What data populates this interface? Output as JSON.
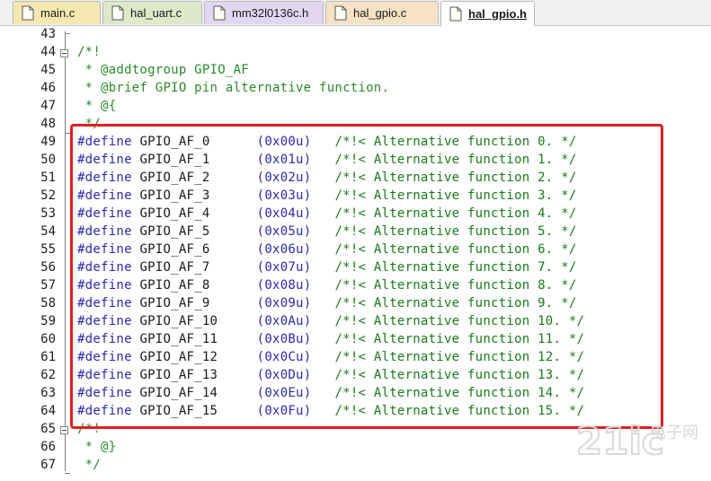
{
  "tabs": [
    {
      "label": "main.c",
      "color": "#f4e8b0",
      "icon": "c-file-icon"
    },
    {
      "label": "hal_uart.c",
      "color": "#dde9c9",
      "icon": "c-file-icon"
    },
    {
      "label": "mm32l0136c.h",
      "color": "#e3d6f0",
      "icon": "h-file-icon"
    },
    {
      "label": "hal_gpio.c",
      "color": "#f6e2c4",
      "icon": "c-file-icon"
    },
    {
      "label": "hal_gpio.h",
      "color": "#ffffff",
      "icon": "h-file-icon",
      "active": true
    }
  ],
  "lines": [
    {
      "no": "43",
      "text": ""
    },
    {
      "no": "44",
      "text": "/*!"
    },
    {
      "no": "45",
      "text": " * @addtogroup GPIO_AF"
    },
    {
      "no": "46",
      "text": " * @brief GPIO pin alternative function."
    },
    {
      "no": "47",
      "text": " * @{"
    },
    {
      "no": "48",
      "text": " */"
    },
    {
      "no": "49",
      "define": "#define",
      "name": "GPIO_AF_0 ",
      "value": "(0x00u)",
      "comment": "/*!< Alternative function 0. */"
    },
    {
      "no": "50",
      "define": "#define",
      "name": "GPIO_AF_1 ",
      "value": "(0x01u)",
      "comment": "/*!< Alternative function 1. */"
    },
    {
      "no": "51",
      "define": "#define",
      "name": "GPIO_AF_2 ",
      "value": "(0x02u)",
      "comment": "/*!< Alternative function 2. */"
    },
    {
      "no": "52",
      "define": "#define",
      "name": "GPIO_AF_3 ",
      "value": "(0x03u)",
      "comment": "/*!< Alternative function 3. */"
    },
    {
      "no": "53",
      "define": "#define",
      "name": "GPIO_AF_4 ",
      "value": "(0x04u)",
      "comment": "/*!< Alternative function 4. */"
    },
    {
      "no": "54",
      "define": "#define",
      "name": "GPIO_AF_5 ",
      "value": "(0x05u)",
      "comment": "/*!< Alternative function 5. */"
    },
    {
      "no": "55",
      "define": "#define",
      "name": "GPIO_AF_6 ",
      "value": "(0x06u)",
      "comment": "/*!< Alternative function 6. */"
    },
    {
      "no": "56",
      "define": "#define",
      "name": "GPIO_AF_7 ",
      "value": "(0x07u)",
      "comment": "/*!< Alternative function 7. */"
    },
    {
      "no": "57",
      "define": "#define",
      "name": "GPIO_AF_8 ",
      "value": "(0x08u)",
      "comment": "/*!< Alternative function 8. */"
    },
    {
      "no": "58",
      "define": "#define",
      "name": "GPIO_AF_9 ",
      "value": "(0x09u)",
      "comment": "/*!< Alternative function 9. */"
    },
    {
      "no": "59",
      "define": "#define",
      "name": "GPIO_AF_10",
      "value": "(0x0Au)",
      "comment": "/*!< Alternative function 10. */"
    },
    {
      "no": "60",
      "define": "#define",
      "name": "GPIO_AF_11",
      "value": "(0x0Bu)",
      "comment": "/*!< Alternative function 11. */"
    },
    {
      "no": "61",
      "define": "#define",
      "name": "GPIO_AF_12",
      "value": "(0x0Cu)",
      "comment": "/*!< Alternative function 12. */"
    },
    {
      "no": "62",
      "define": "#define",
      "name": "GPIO_AF_13",
      "value": "(0x0Du)",
      "comment": "/*!< Alternative function 13. */"
    },
    {
      "no": "63",
      "define": "#define",
      "name": "GPIO_AF_14",
      "value": "(0x0Eu)",
      "comment": "/*!< Alternative function 14. */"
    },
    {
      "no": "64",
      "define": "#define",
      "name": "GPIO_AF_15",
      "value": "(0x0Fu)",
      "comment": "/*!< Alternative function 15. */"
    },
    {
      "no": "65",
      "text": "/*!"
    },
    {
      "no": "66",
      "text": " * @}"
    },
    {
      "no": "67",
      "text": " */"
    }
  ],
  "watermark": {
    "text": "21ic",
    "subtext": "电子网"
  },
  "colors": {
    "highlight": "#e02020",
    "comment": "#2a8a2a",
    "keyword": "#2a2aa8"
  }
}
